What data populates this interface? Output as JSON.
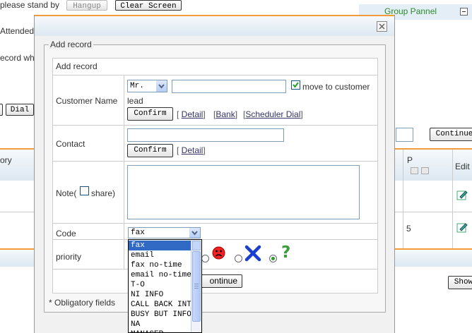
{
  "background": {
    "standby_text": "please stand by",
    "hangup_label": "Hangup",
    "clear_screen_label": "Clear Screen",
    "group_panel_title": "Group Pannel",
    "attended_text": "Attended",
    "record_text": "ecord wh",
    "dial_label": "Dial",
    "continue_label": "Continue",
    "history_header": "ory",
    "p_header": "P",
    "edit_header": "Edit",
    "row_value": "5",
    "show_label": "Show"
  },
  "dialog": {
    "legend": "Add record",
    "section_title": "Add record",
    "customer_name_label": "Customer Name",
    "title_select": "Mr.",
    "move_to_customer_label": "move to customer",
    "move_to_customer_checked": true,
    "lead_text": "lead",
    "confirm_label": "Confirm",
    "detail_link": "Detail",
    "bank_link": "Bank",
    "scheduler_link": "Scheduler Dial",
    "contact_label": "Contact",
    "note_label_prefix": "Note(",
    "share_label": "share)",
    "code_label": "Code",
    "code_selected": "fax",
    "code_options": [
      "fax",
      "email",
      "fax no-time",
      "email no-time",
      "T-O",
      "NI INFO",
      "CALL BACK INT",
      "BUSY BUT INFO",
      "NA",
      "MANAGER"
    ],
    "priority_label": "priority",
    "continue_label": "ontinue",
    "obligatory_text": "* Obligatory fields"
  },
  "colors": {
    "accent_orange": "#f39a3a",
    "header_blue": "#dde8f1",
    "selection_blue": "#316ac5",
    "group_green": "#2e8b2e"
  },
  "icons": [
    "close-icon",
    "minimize-icon",
    "edit-icon",
    "sad-face-icon",
    "x-mark-icon",
    "question-icon",
    "dropdown-arrow-icon"
  ]
}
